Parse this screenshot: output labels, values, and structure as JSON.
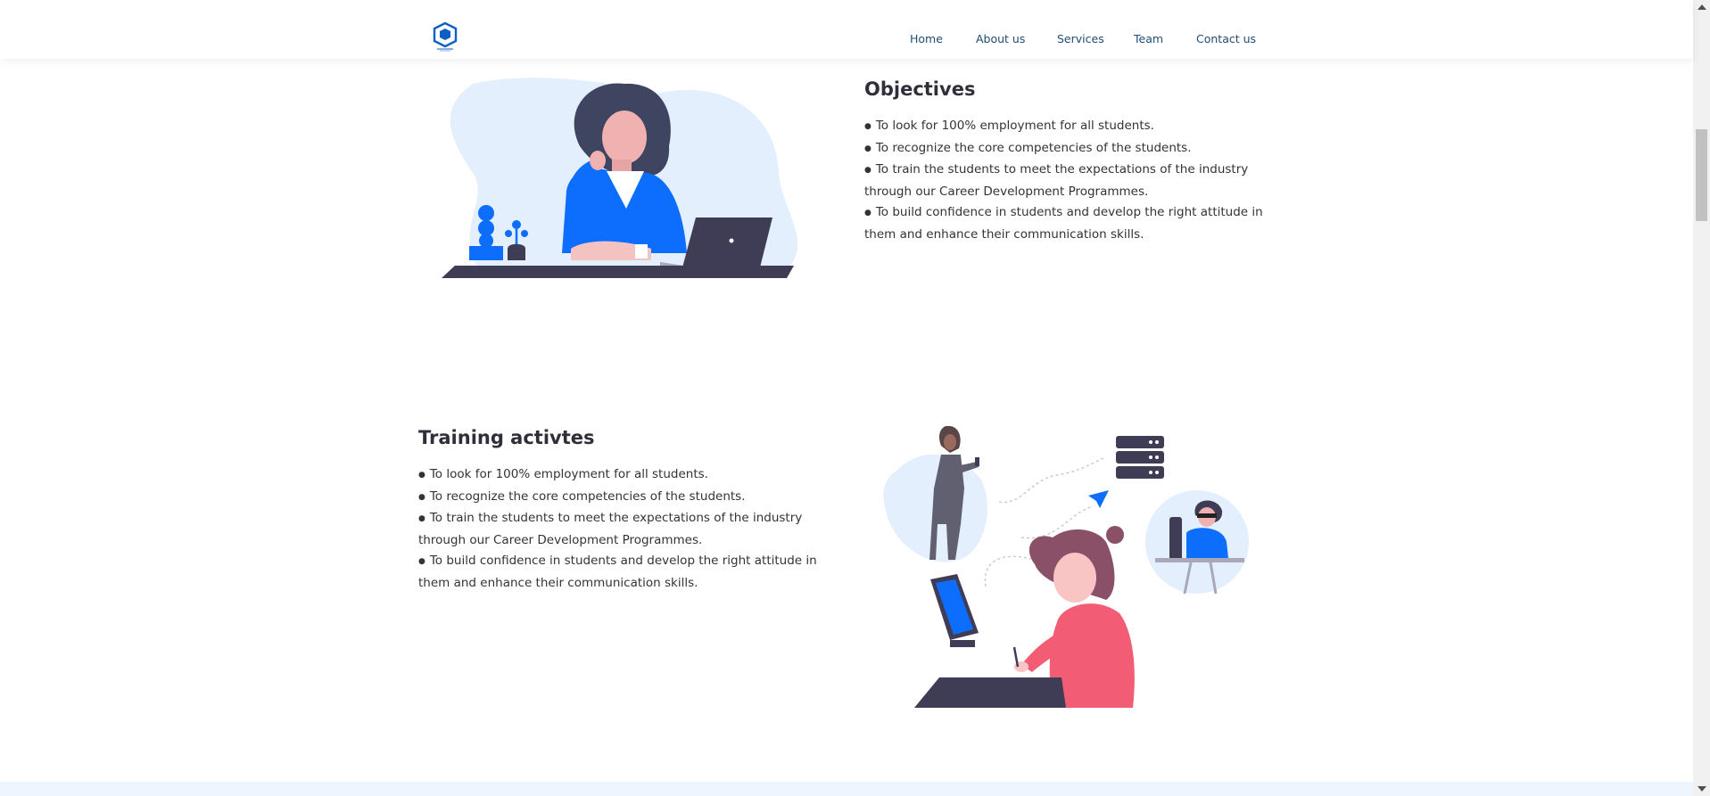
{
  "nav": {
    "logo_alt": "Company logo",
    "items": [
      "Home",
      "About us",
      "Services",
      "Team",
      "Contact us"
    ]
  },
  "objectives": {
    "title": "Objectives",
    "items": [
      "To look for 100% employment for all students.",
      "To recognize the core competencies of the students.",
      "To train the students to meet the expectations of the industry",
      "through our Career Development Programmes.",
      "To build confidence in students and develop the right attitude in",
      "them and enhance their communication skills."
    ]
  },
  "training": {
    "title": "Training activtes",
    "items": [
      "To look for 100% employment for all students.",
      "To recognize the core competencies of the students.",
      "To train the students to meet the expectations of the industry",
      "through our Career Development Programmes.",
      "To build confidence in students and develop the right attitude in",
      "them and enhance their communication skills."
    ]
  },
  "colors": {
    "accent": "#0d6efd",
    "nav_text": "#1f4c73",
    "heading": "#2f2f3a",
    "blob": "#e3effd",
    "dark_navy": "#3f3d56",
    "pink_shirt": "#f25c74",
    "hair_mauve": "#8a5068"
  },
  "icons": {
    "logo": "cube-logo-icon",
    "illustration_1": "woman-at-laptop-illustration",
    "illustration_2": "designer-at-computer-illustration"
  }
}
